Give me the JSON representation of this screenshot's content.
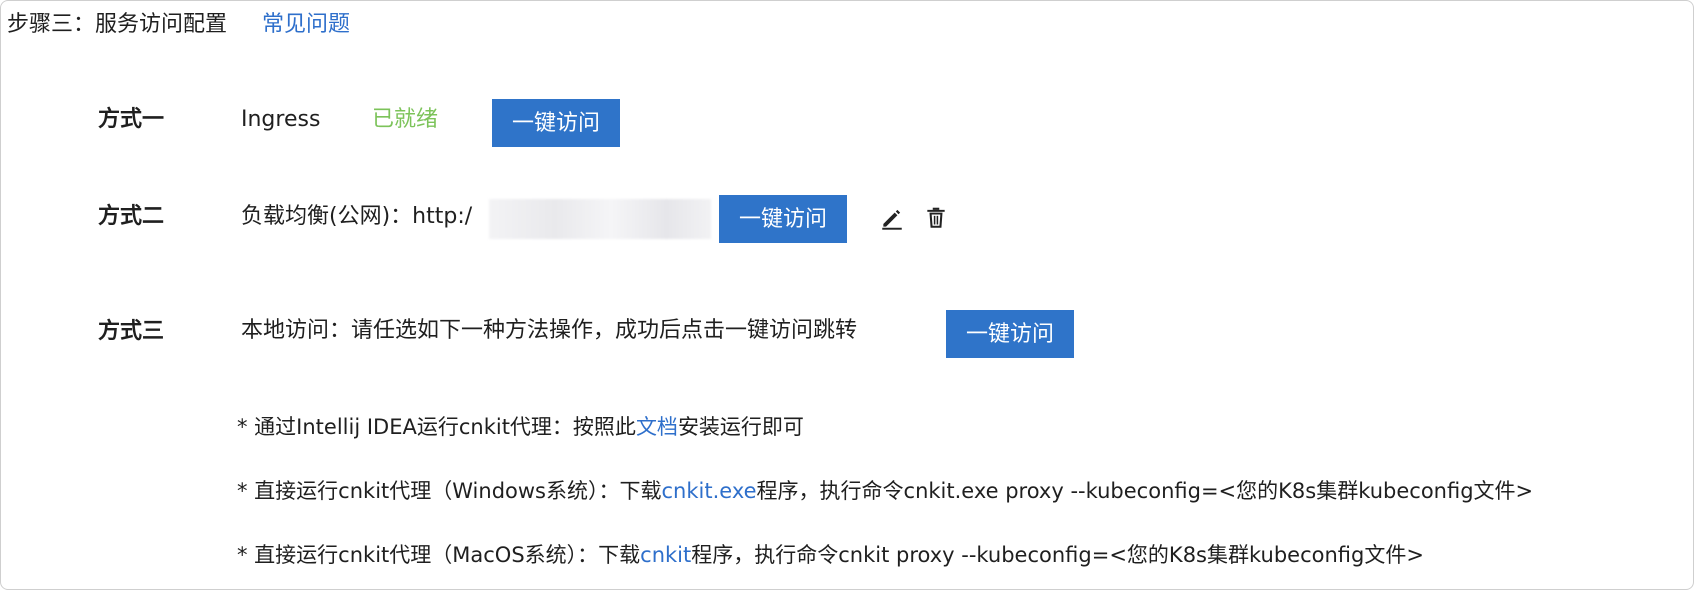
{
  "step": {
    "title": "步骤三：服务访问配置",
    "faq_link": "常见问题"
  },
  "methods": [
    {
      "label": "方式一",
      "text": "Ingress",
      "status": "已就绪",
      "button": "一键访问"
    },
    {
      "label": "方式二",
      "text": "负载均衡(公网)：http:/",
      "button": "一键访问",
      "edit_icon": "edit-icon",
      "delete_icon": "trash-icon"
    },
    {
      "label": "方式三",
      "text": "本地访问：请任选如下一种方法操作，成功后点击一键访问跳转",
      "button": "一键访问"
    }
  ],
  "notes": [
    {
      "prefix": "* 通过Intellij IDEA运行cnkit代理：按照此",
      "link": "文档",
      "suffix": "安装运行即可"
    },
    {
      "prefix": "* 直接运行cnkit代理（Windows系统）：下载",
      "link": "cnkit.exe",
      "suffix": "程序，执行命令cnkit.exe proxy --kubeconfig=<您的K8s集群kubeconfig文件>"
    },
    {
      "prefix": "* 直接运行cnkit代理（MacOS系统）：下载",
      "link": "cnkit",
      "suffix": "程序，执行命令cnkit proxy --kubeconfig=<您的K8s集群kubeconfig文件>"
    }
  ],
  "colors": {
    "primary_button": "#2f74c9",
    "link": "#2e6fcb",
    "ready_status": "#7cc35a"
  }
}
